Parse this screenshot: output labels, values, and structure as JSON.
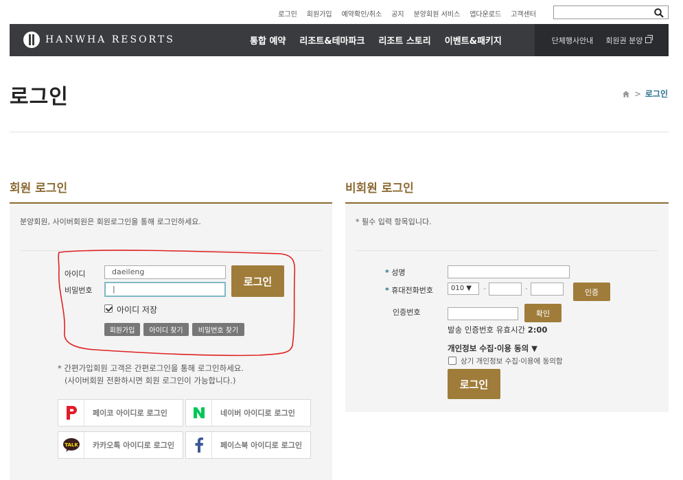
{
  "utility": {
    "links": [
      "로그인",
      "회원가입",
      "예약확인/취소",
      "공지",
      "분양회원 서비스",
      "앱다운로드",
      "고객센터"
    ],
    "search_placeholder": ""
  },
  "nav": {
    "logo_text": "HANWHA RESORTS",
    "items": [
      "통합 예약",
      "리조트&테마파크",
      "리조트 스토리",
      "이벤트&패키지"
    ],
    "right_items": [
      "단체행사안내",
      "회원권 분양"
    ]
  },
  "page": {
    "title": "로그인",
    "breadcrumb_current": "로그인"
  },
  "member": {
    "section_title": "회원 로그인",
    "note": "분양회원, 사이버회원은 회원로그인을 통해 로그인하세요.",
    "id_label": "아이디",
    "id_value": "daeileng",
    "pw_label": "비밀번호",
    "pw_value": "|",
    "login_button": "로그인",
    "save_id_label": "아이디 저장",
    "save_id_checked": true,
    "buttons": [
      "회원가입",
      "아이디 찾기",
      "비밀번호 찾기"
    ],
    "simple_note_1": "* 간편가입회원 고객은 간편로그인을 통해 로그인하세요.",
    "simple_note_2": "(사이버회원 전환하시면 회원 로그인이 가능합니다.)",
    "social": [
      {
        "label": "페이코 아이디로 로그인",
        "icon": "payco-icon"
      },
      {
        "label": "네이버 아이디로 로그인",
        "icon": "naver-icon"
      },
      {
        "label": "카카오톡 아이디로 로그인",
        "icon": "kakaotalk-icon"
      },
      {
        "label": "페이스북 아이디로 로그인",
        "icon": "facebook-icon"
      }
    ]
  },
  "nonmember": {
    "section_title": "비회원 로그인",
    "note": "* 필수 입력 항목입니다.",
    "name_label": "성명",
    "phone_label": "휴대전화번호",
    "phone_prefix": "010",
    "phone_prefix_arrow": "▼",
    "dash": "-",
    "verify_button": "인증",
    "code_label": "인증번호",
    "confirm_button": "확인",
    "timer_label": "발송 인증번호 유효시간",
    "timer_value": "2:00",
    "consent_title": "개인정보 수집·이용 동의 ▼",
    "consent_label": "상기 개인정보 수집·이용에 동의함",
    "consent_checked": false,
    "login_button": "로그인",
    "required_mark": "*"
  },
  "colors": {
    "nav_bg": "#3a3b3e",
    "gold": "#a07c3a",
    "section_title": "#8a6a32",
    "annotation": "#e02020"
  },
  "social_label": {
    "kakao_talk": "TALK"
  }
}
